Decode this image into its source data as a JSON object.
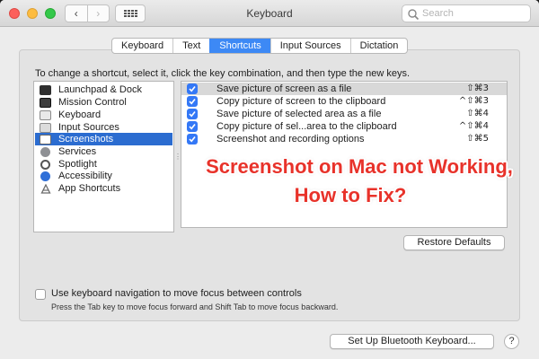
{
  "window": {
    "title": "Keyboard",
    "nav_back": "‹",
    "nav_forward": "›",
    "search_placeholder": "Search"
  },
  "tabs": [
    {
      "label": "Keyboard",
      "active": false
    },
    {
      "label": "Text",
      "active": false
    },
    {
      "label": "Shortcuts",
      "active": true
    },
    {
      "label": "Input Sources",
      "active": false
    },
    {
      "label": "Dictation",
      "active": false
    }
  ],
  "instruction": "To change a shortcut, select it, click the key combination, and then type the new keys.",
  "categories": [
    {
      "label": "Launchpad & Dock",
      "icon": "launchpad-icon",
      "selected": false
    },
    {
      "label": "Mission Control",
      "icon": "mission-control-icon",
      "selected": false
    },
    {
      "label": "Keyboard",
      "icon": "keyboard-icon",
      "selected": false
    },
    {
      "label": "Input Sources",
      "icon": "input-sources-icon",
      "selected": false
    },
    {
      "label": "Screenshots",
      "icon": "screenshot-icon",
      "selected": true
    },
    {
      "label": "Services",
      "icon": "gear-icon",
      "selected": false
    },
    {
      "label": "Spotlight",
      "icon": "spotlight-icon",
      "selected": false
    },
    {
      "label": "Accessibility",
      "icon": "accessibility-icon",
      "selected": false
    },
    {
      "label": "App Shortcuts",
      "icon": "app-shortcuts-icon",
      "selected": false
    }
  ],
  "shortcuts": [
    {
      "label": "Save picture of screen as a file",
      "keys": "⇧⌘3",
      "checked": true
    },
    {
      "label": "Copy picture of screen to the clipboard",
      "keys": "^⇧⌘3",
      "checked": true
    },
    {
      "label": "Save picture of selected area as a file",
      "keys": "⇧⌘4",
      "checked": true
    },
    {
      "label": "Copy picture of sel...area to the clipboard",
      "keys": "^⇧⌘4",
      "checked": true
    },
    {
      "label": "Screenshot and recording options",
      "keys": "⇧⌘5",
      "checked": true
    }
  ],
  "overlay": {
    "line1": "Screenshot on Mac not Working,",
    "line2": "How to Fix?",
    "color": "#e8322a"
  },
  "buttons": {
    "restore_defaults": "Restore Defaults",
    "bluetooth_keyboard": "Set Up Bluetooth Keyboard...",
    "help": "?"
  },
  "keyboard_navigation": {
    "label": "Use keyboard navigation to move focus between controls",
    "hint": "Press the Tab key to move focus forward and Shift Tab to move focus backward.",
    "checked": false
  },
  "colors": {
    "accent": "#3d89f5",
    "selection": "#2b6cd0",
    "checkbox": "#3478f6"
  }
}
